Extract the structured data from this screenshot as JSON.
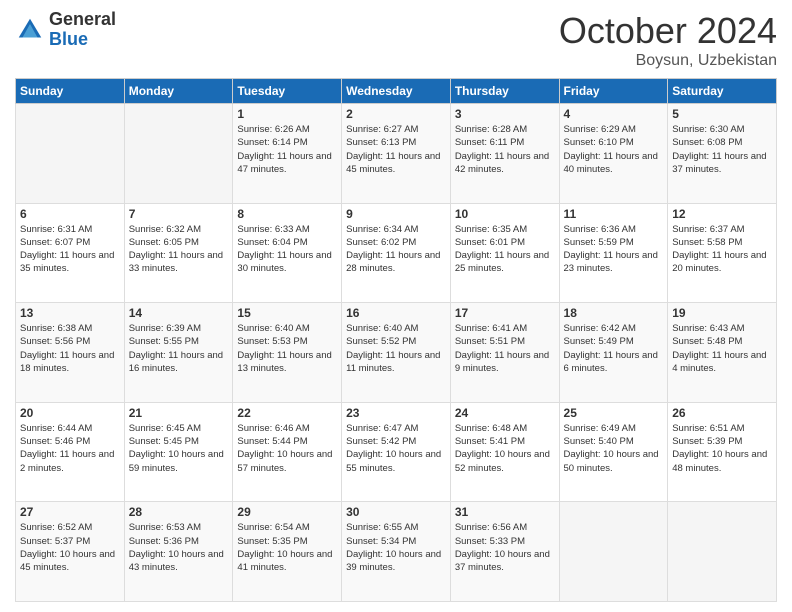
{
  "header": {
    "logo_general": "General",
    "logo_blue": "Blue",
    "month_title": "October 2024",
    "location": "Boysun, Uzbekistan"
  },
  "days_of_week": [
    "Sunday",
    "Monday",
    "Tuesday",
    "Wednesday",
    "Thursday",
    "Friday",
    "Saturday"
  ],
  "weeks": [
    [
      {
        "day": "",
        "sunrise": "",
        "sunset": "",
        "daylight": ""
      },
      {
        "day": "",
        "sunrise": "",
        "sunset": "",
        "daylight": ""
      },
      {
        "day": "1",
        "sunrise": "Sunrise: 6:26 AM",
        "sunset": "Sunset: 6:14 PM",
        "daylight": "Daylight: 11 hours and 47 minutes."
      },
      {
        "day": "2",
        "sunrise": "Sunrise: 6:27 AM",
        "sunset": "Sunset: 6:13 PM",
        "daylight": "Daylight: 11 hours and 45 minutes."
      },
      {
        "day": "3",
        "sunrise": "Sunrise: 6:28 AM",
        "sunset": "Sunset: 6:11 PM",
        "daylight": "Daylight: 11 hours and 42 minutes."
      },
      {
        "day": "4",
        "sunrise": "Sunrise: 6:29 AM",
        "sunset": "Sunset: 6:10 PM",
        "daylight": "Daylight: 11 hours and 40 minutes."
      },
      {
        "day": "5",
        "sunrise": "Sunrise: 6:30 AM",
        "sunset": "Sunset: 6:08 PM",
        "daylight": "Daylight: 11 hours and 37 minutes."
      }
    ],
    [
      {
        "day": "6",
        "sunrise": "Sunrise: 6:31 AM",
        "sunset": "Sunset: 6:07 PM",
        "daylight": "Daylight: 11 hours and 35 minutes."
      },
      {
        "day": "7",
        "sunrise": "Sunrise: 6:32 AM",
        "sunset": "Sunset: 6:05 PM",
        "daylight": "Daylight: 11 hours and 33 minutes."
      },
      {
        "day": "8",
        "sunrise": "Sunrise: 6:33 AM",
        "sunset": "Sunset: 6:04 PM",
        "daylight": "Daylight: 11 hours and 30 minutes."
      },
      {
        "day": "9",
        "sunrise": "Sunrise: 6:34 AM",
        "sunset": "Sunset: 6:02 PM",
        "daylight": "Daylight: 11 hours and 28 minutes."
      },
      {
        "day": "10",
        "sunrise": "Sunrise: 6:35 AM",
        "sunset": "Sunset: 6:01 PM",
        "daylight": "Daylight: 11 hours and 25 minutes."
      },
      {
        "day": "11",
        "sunrise": "Sunrise: 6:36 AM",
        "sunset": "Sunset: 5:59 PM",
        "daylight": "Daylight: 11 hours and 23 minutes."
      },
      {
        "day": "12",
        "sunrise": "Sunrise: 6:37 AM",
        "sunset": "Sunset: 5:58 PM",
        "daylight": "Daylight: 11 hours and 20 minutes."
      }
    ],
    [
      {
        "day": "13",
        "sunrise": "Sunrise: 6:38 AM",
        "sunset": "Sunset: 5:56 PM",
        "daylight": "Daylight: 11 hours and 18 minutes."
      },
      {
        "day": "14",
        "sunrise": "Sunrise: 6:39 AM",
        "sunset": "Sunset: 5:55 PM",
        "daylight": "Daylight: 11 hours and 16 minutes."
      },
      {
        "day": "15",
        "sunrise": "Sunrise: 6:40 AM",
        "sunset": "Sunset: 5:53 PM",
        "daylight": "Daylight: 11 hours and 13 minutes."
      },
      {
        "day": "16",
        "sunrise": "Sunrise: 6:40 AM",
        "sunset": "Sunset: 5:52 PM",
        "daylight": "Daylight: 11 hours and 11 minutes."
      },
      {
        "day": "17",
        "sunrise": "Sunrise: 6:41 AM",
        "sunset": "Sunset: 5:51 PM",
        "daylight": "Daylight: 11 hours and 9 minutes."
      },
      {
        "day": "18",
        "sunrise": "Sunrise: 6:42 AM",
        "sunset": "Sunset: 5:49 PM",
        "daylight": "Daylight: 11 hours and 6 minutes."
      },
      {
        "day": "19",
        "sunrise": "Sunrise: 6:43 AM",
        "sunset": "Sunset: 5:48 PM",
        "daylight": "Daylight: 11 hours and 4 minutes."
      }
    ],
    [
      {
        "day": "20",
        "sunrise": "Sunrise: 6:44 AM",
        "sunset": "Sunset: 5:46 PM",
        "daylight": "Daylight: 11 hours and 2 minutes."
      },
      {
        "day": "21",
        "sunrise": "Sunrise: 6:45 AM",
        "sunset": "Sunset: 5:45 PM",
        "daylight": "Daylight: 10 hours and 59 minutes."
      },
      {
        "day": "22",
        "sunrise": "Sunrise: 6:46 AM",
        "sunset": "Sunset: 5:44 PM",
        "daylight": "Daylight: 10 hours and 57 minutes."
      },
      {
        "day": "23",
        "sunrise": "Sunrise: 6:47 AM",
        "sunset": "Sunset: 5:42 PM",
        "daylight": "Daylight: 10 hours and 55 minutes."
      },
      {
        "day": "24",
        "sunrise": "Sunrise: 6:48 AM",
        "sunset": "Sunset: 5:41 PM",
        "daylight": "Daylight: 10 hours and 52 minutes."
      },
      {
        "day": "25",
        "sunrise": "Sunrise: 6:49 AM",
        "sunset": "Sunset: 5:40 PM",
        "daylight": "Daylight: 10 hours and 50 minutes."
      },
      {
        "day": "26",
        "sunrise": "Sunrise: 6:51 AM",
        "sunset": "Sunset: 5:39 PM",
        "daylight": "Daylight: 10 hours and 48 minutes."
      }
    ],
    [
      {
        "day": "27",
        "sunrise": "Sunrise: 6:52 AM",
        "sunset": "Sunset: 5:37 PM",
        "daylight": "Daylight: 10 hours and 45 minutes."
      },
      {
        "day": "28",
        "sunrise": "Sunrise: 6:53 AM",
        "sunset": "Sunset: 5:36 PM",
        "daylight": "Daylight: 10 hours and 43 minutes."
      },
      {
        "day": "29",
        "sunrise": "Sunrise: 6:54 AM",
        "sunset": "Sunset: 5:35 PM",
        "daylight": "Daylight: 10 hours and 41 minutes."
      },
      {
        "day": "30",
        "sunrise": "Sunrise: 6:55 AM",
        "sunset": "Sunset: 5:34 PM",
        "daylight": "Daylight: 10 hours and 39 minutes."
      },
      {
        "day": "31",
        "sunrise": "Sunrise: 6:56 AM",
        "sunset": "Sunset: 5:33 PM",
        "daylight": "Daylight: 10 hours and 37 minutes."
      },
      {
        "day": "",
        "sunrise": "",
        "sunset": "",
        "daylight": ""
      },
      {
        "day": "",
        "sunrise": "",
        "sunset": "",
        "daylight": ""
      }
    ]
  ]
}
